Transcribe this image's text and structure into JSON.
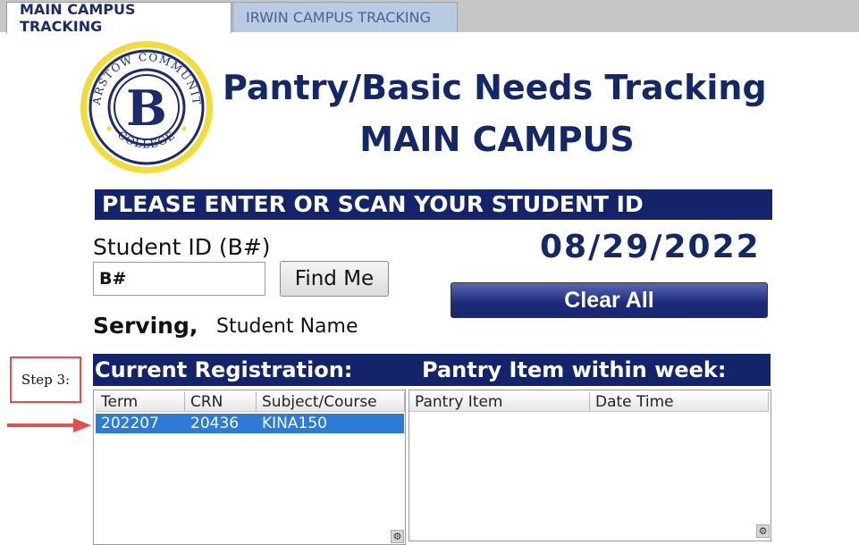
{
  "tabs": [
    {
      "label": "MAIN CAMPUS TRACKING",
      "active": true
    },
    {
      "label": "IRWIN CAMPUS TRACKING",
      "active": false
    }
  ],
  "logo": {
    "text_top": "BARSTOW COMMUNITY",
    "text_bottom": "COLLEGE",
    "letter": "B"
  },
  "header": {
    "title_line1": "Pantry/Basic Needs Tracking",
    "title_line2": "MAIN CAMPUS"
  },
  "banner": "PLEASE ENTER OR SCAN YOUR STUDENT ID",
  "student_id": {
    "label": "Student ID (B#)",
    "value": "B#",
    "find_label": "Find Me"
  },
  "date": "08/29/2022",
  "clear_label": "Clear All",
  "serving": {
    "label": "Serving,",
    "name": "Student Name"
  },
  "sections": {
    "registration": "Current Registration:",
    "pantry": "Pantry Item within week:"
  },
  "annotation": {
    "step": "Step 3:"
  },
  "registration_table": {
    "columns": [
      "Term",
      "CRN",
      "Subject/Course"
    ],
    "rows": [
      {
        "term": "202207",
        "crn": "20436",
        "course": "KINA150",
        "selected": true
      }
    ]
  },
  "pantry_table": {
    "columns": [
      "Pantry Item",
      "Date Time"
    ],
    "rows": []
  },
  "colors": {
    "navy": "#13246a",
    "selection": "#2e7bd6",
    "annotation_red": "#e05050",
    "logo_gold": "#f2dc3a"
  }
}
